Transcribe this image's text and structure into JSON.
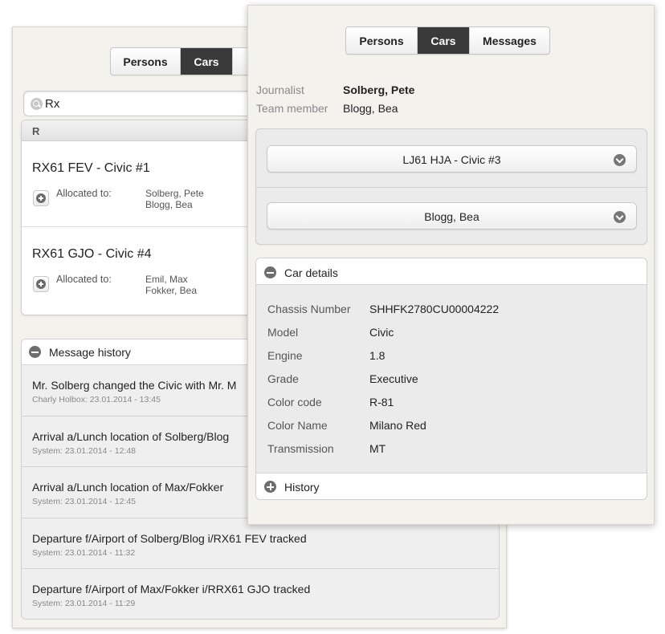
{
  "back": {
    "tabs": [
      "Persons",
      "Cars",
      ""
    ],
    "search": {
      "value": "Rx"
    },
    "list_header": "R",
    "allocated_label": "Allocated to:",
    "cars": [
      {
        "title": "RX61 FEV - Civic #1",
        "names": [
          "Solberg, Pete",
          "Blogg, Bea"
        ]
      },
      {
        "title": "RX61 GJO - Civic #4",
        "names": [
          "Emil, Max",
          "Fokker, Bea"
        ]
      }
    ],
    "message_history": {
      "title": "Message history",
      "items": [
        {
          "text": "Mr. Solberg changed the Civic with Mr. M",
          "meta": "Charly Holbox: 23.01.2014 - 13:45"
        },
        {
          "text": "Arrival a/Lunch location of Solberg/Blog",
          "meta": "System: 23.01.2014 - 12:48"
        },
        {
          "text": "Arrival a/Lunch location of Max/Fokker",
          "meta": "System: 23.01.2014 - 12:45"
        },
        {
          "text": "Departure f/Airport of Solberg/Blog i/RX61 FEV tracked",
          "meta": "System: 23.01.2014 - 11:32"
        },
        {
          "text": "Departure f/Airport of Max/Fokker i/RRX61 GJO tracked",
          "meta": "System: 23.01.2014 - 11:29"
        }
      ]
    }
  },
  "front": {
    "tabs": [
      "Persons",
      "Cars",
      "Messages"
    ],
    "info": [
      {
        "label": "Journalist",
        "value": "Solberg, Pete"
      },
      {
        "label": "Team member",
        "value": "Blogg, Bea"
      }
    ],
    "car_select": "LJ61 HJA - Civic #3",
    "person_select": "Blogg, Bea",
    "car_details": {
      "title": "Car details",
      "rows": [
        {
          "label": "Chassis Number",
          "value": "SHHFK2780CU00004222"
        },
        {
          "label": "Model",
          "value": "Civic"
        },
        {
          "label": "Engine",
          "value": "1.8"
        },
        {
          "label": "Grade",
          "value": "Executive"
        },
        {
          "label": "Color code",
          "value": "R-81"
        },
        {
          "label": "Color Name",
          "value": "Milano Red"
        },
        {
          "label": "Transmission",
          "value": "MT"
        }
      ]
    },
    "history_title": "History"
  },
  "colors": {
    "panel_bg": "#f4f2ec",
    "active_tab": "#3a3a3a",
    "icon_gray": "#6e6e6e"
  }
}
